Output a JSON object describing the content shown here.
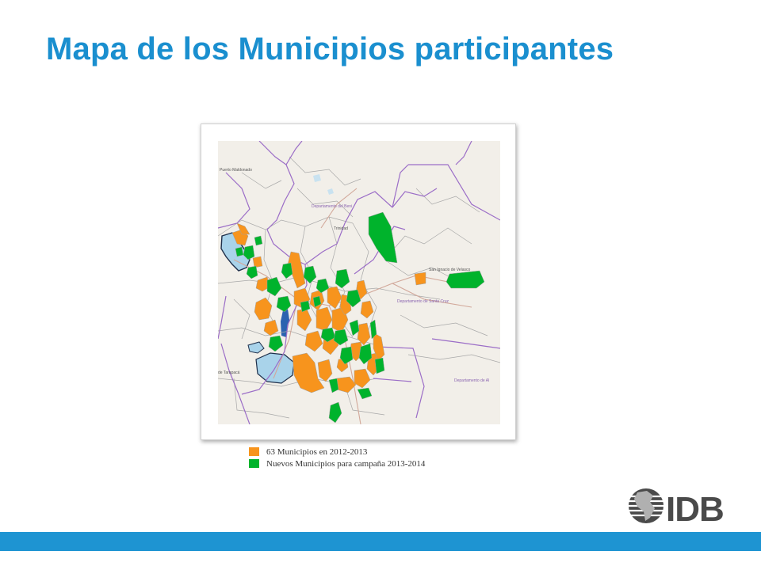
{
  "page": {
    "title": "Mapa de los Municipios participantes"
  },
  "colors": {
    "title": "#1a8fcf",
    "footer_bar": "#1e94d2",
    "participating_2012_2013": "#f7941d",
    "new_2013_2014": "#00b32c",
    "department_border": "#9b6dc7",
    "lake": "#a9d3ea",
    "land": "#f2efe9"
  },
  "map": {
    "place_labels": [
      "Puerto Maldonado",
      "Departamento del Beni",
      "Trinidad",
      "San Ignacio de Velasco",
      "Departamento de Santa Cruz",
      "Departamento de Al",
      "de Tarapacá"
    ]
  },
  "legend": {
    "items": [
      {
        "label": "63 Municipios en 2012-2013",
        "color": "#f7941d"
      },
      {
        "label": "Nuevos Municipios para campaña 2013-2014",
        "color": "#00b32c"
      }
    ]
  },
  "logo": {
    "text": "IDB",
    "icon": "globe-icon"
  }
}
